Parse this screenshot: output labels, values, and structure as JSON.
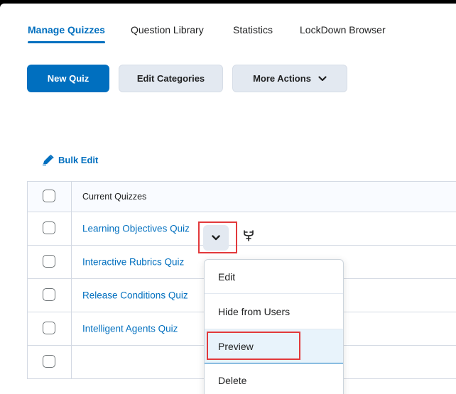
{
  "tabs": [
    "Manage Quizzes",
    "Question Library",
    "Statistics",
    "LockDown Browser"
  ],
  "buttons": {
    "new_quiz": "New Quiz",
    "edit_categories": "Edit Categories",
    "more_actions": "More Actions"
  },
  "bulk_edit": "Bulk Edit",
  "table": {
    "header": "Current Quizzes",
    "rows": [
      "Learning Objectives Quiz",
      "Interactive Rubrics Quiz",
      "Release Conditions Quiz",
      "Intelligent Agents Quiz"
    ]
  },
  "context_menu": {
    "items": [
      "Edit",
      "Hide from Users",
      "Preview",
      "Delete"
    ],
    "highlighted": "Preview"
  },
  "colors": {
    "accent": "#006fbf",
    "secondary_button": "#e3e9f1",
    "annotation": "#e2393b"
  },
  "icons": [
    "pencil-icon",
    "chevron-down-icon",
    "release-conditions-icon"
  ]
}
